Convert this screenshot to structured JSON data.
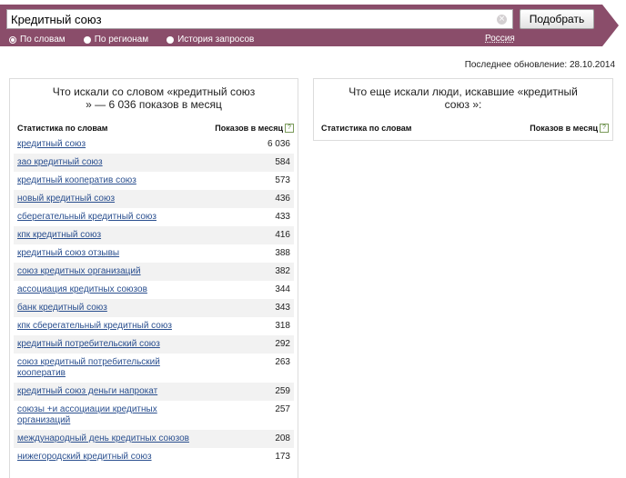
{
  "search": {
    "value": "Кредитный союз",
    "submit_label": "Подобрать"
  },
  "modes": [
    {
      "label": "По словам",
      "checked": true
    },
    {
      "label": "По регионам",
      "checked": false
    },
    {
      "label": "История запросов",
      "checked": false
    }
  ],
  "region": "Россия",
  "last_update": "Последнее обновление: 28.10.2014",
  "left_panel": {
    "title_line1": "Что искали со словом «кредитный союз",
    "title_line2": "» — 6 036 показов в месяц",
    "col_keywords": "Статистика по словам",
    "col_shows": "Показов в месяц",
    "rows": [
      {
        "keyword": "кредитный союз",
        "count": "6 036"
      },
      {
        "keyword": "зао кредитный союз",
        "count": "584"
      },
      {
        "keyword": "кредитный кооператив союз",
        "count": "573"
      },
      {
        "keyword": "новый кредитный союз",
        "count": "436"
      },
      {
        "keyword": "сберегательный кредитный союз",
        "count": "433"
      },
      {
        "keyword": "кпк кредитный союз",
        "count": "416"
      },
      {
        "keyword": "кредитный союз отзывы",
        "count": "388"
      },
      {
        "keyword": "союз кредитных организаций",
        "count": "382"
      },
      {
        "keyword": "ассоциация кредитных союзов",
        "count": "344"
      },
      {
        "keyword": "банк кредитный союз",
        "count": "343"
      },
      {
        "keyword": "кпк сберегательный кредитный союз",
        "count": "318"
      },
      {
        "keyword": "кредитный потребительский союз",
        "count": "292"
      },
      {
        "keyword": "союз кредитный потребительский кооператив",
        "count": "263"
      },
      {
        "keyword": "кредитный союз деньги напрокат",
        "count": "259"
      },
      {
        "keyword": "союзы +и ассоциации кредитных организаций",
        "count": "257"
      },
      {
        "keyword": "международный день кредитных союзов",
        "count": "208"
      },
      {
        "keyword": "нижегородский кредитный союз",
        "count": "173"
      }
    ]
  },
  "right_panel": {
    "title_line1": "Что еще искали люди, искавшие «кредитный",
    "title_line2": "союз »:",
    "col_keywords": "Статистика по словам",
    "col_shows": "Показов в месяц"
  },
  "icons": {
    "clear": "clear-icon",
    "help": "help-icon"
  },
  "colors": {
    "header_band": "#8a4d6a",
    "link": "#2a4f8f",
    "stripe": "#f2f2f2"
  }
}
